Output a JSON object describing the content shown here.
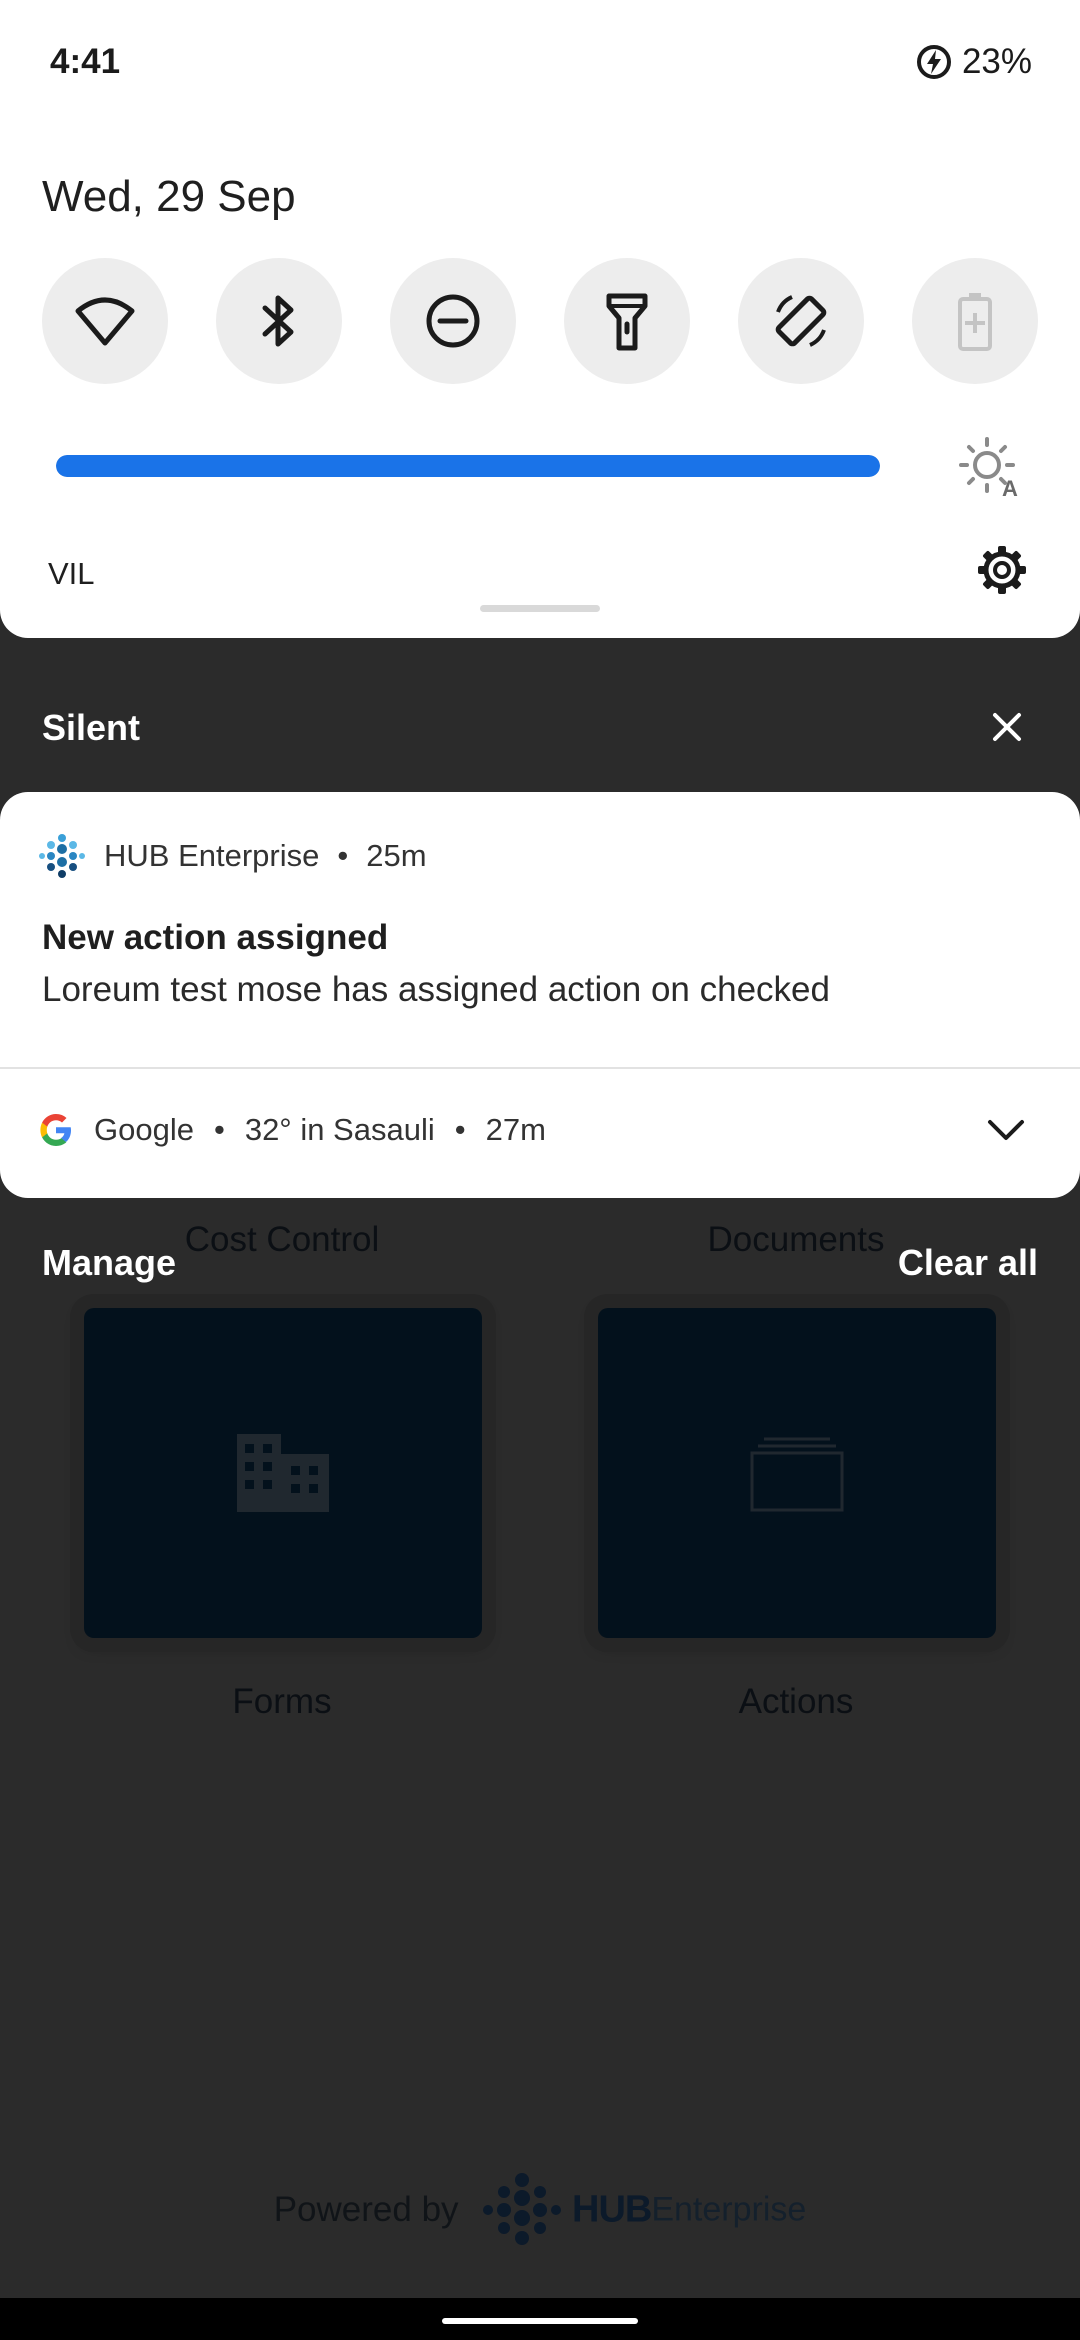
{
  "status_bar": {
    "time": "4:41",
    "battery": "23%",
    "battery_icon": "battery-charging-icon"
  },
  "quick_settings": {
    "date": "Wed, 29 Sep",
    "tiles": [
      {
        "name": "wifi",
        "icon": "wifi-icon",
        "active": false
      },
      {
        "name": "bluetooth",
        "icon": "bluetooth-icon",
        "active": false
      },
      {
        "name": "do-not-disturb",
        "icon": "do-not-disturb-icon",
        "active": false
      },
      {
        "name": "flashlight",
        "icon": "flashlight-icon",
        "active": false
      },
      {
        "name": "auto-rotate",
        "icon": "auto-rotate-icon",
        "active": false
      },
      {
        "name": "battery-saver",
        "icon": "battery-saver-icon",
        "active": false,
        "disabled": true
      }
    ],
    "brightness": 1.0,
    "carrier": "VIL",
    "accent": "#1a73e8"
  },
  "shade": {
    "section_title": "Silent",
    "manage_label": "Manage",
    "clear_all_label": "Clear all"
  },
  "notifications": [
    {
      "app": "HUB Enterprise",
      "time": "25m",
      "title": "New action assigned",
      "text": "Loreum test mose has assigned action on checked"
    },
    {
      "app": "Google",
      "summary": "32° in Sasauli",
      "time": "27m"
    }
  ],
  "background_app": {
    "labels": [
      "Cost Control",
      "Documents",
      "Forms",
      "Actions"
    ],
    "powered_by": "Powered by",
    "brand_hub": "HUB",
    "brand_enterprise": "Enterprise"
  }
}
